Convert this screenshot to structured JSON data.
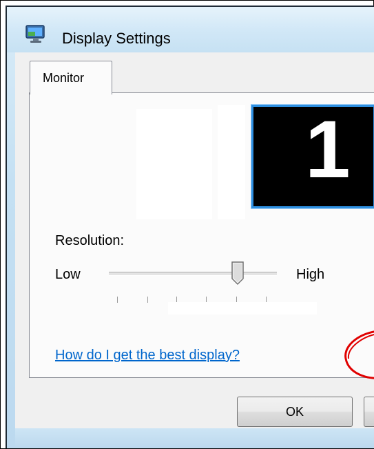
{
  "window": {
    "title": "Display Settings",
    "icon": "display-settings-icon"
  },
  "tabs": [
    {
      "label": "Monitor",
      "selected": true
    }
  ],
  "monitor": {
    "number": "1",
    "accent_color": "#2e8fe0"
  },
  "resolution": {
    "label": "Resolution:",
    "low_label": "Low",
    "high_label": "High",
    "slider_level": 0.77,
    "tick_count": 6
  },
  "help_link": "How do I get the best display?",
  "buttons": {
    "ok": "OK"
  },
  "annotation": {
    "type": "red-hand-drawn-circle",
    "color": "#e00000"
  }
}
